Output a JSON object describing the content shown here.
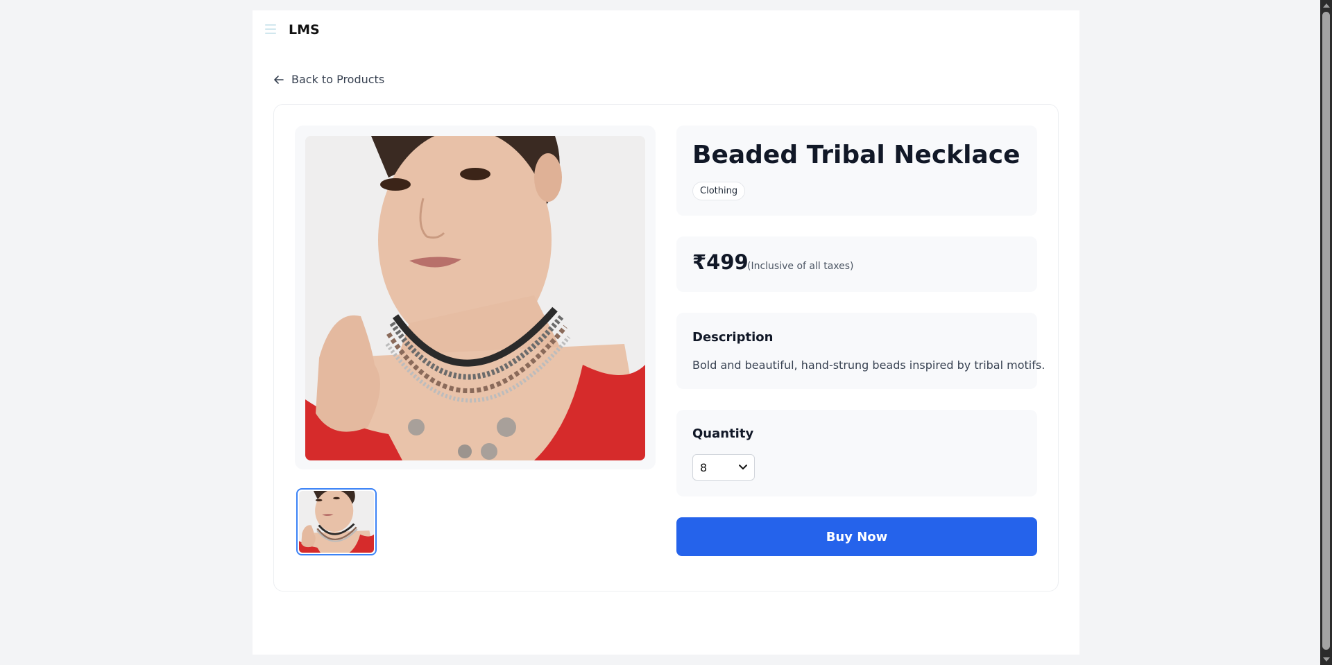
{
  "header": {
    "brand": "LMS",
    "menu_icon": "hamburger-menu-icon"
  },
  "nav": {
    "back_label": "Back to Products",
    "back_icon": "arrow-left-icon"
  },
  "product": {
    "title": "Beaded Tribal Necklace",
    "category": "Clothing",
    "price": "₹499",
    "price_note": "(Inclusive of all taxes)",
    "description_heading": "Description",
    "description": "Bold and beautiful, hand-strung beads inspired by tribal motifs.",
    "quantity_label": "Quantity",
    "quantity_value": "8",
    "buy_label": "Buy Now"
  },
  "colors": {
    "accent": "#2563eb",
    "thumb_border": "#3b82f6",
    "card_bg": "#f8f9fb",
    "page_bg": "#f3f4f6"
  }
}
